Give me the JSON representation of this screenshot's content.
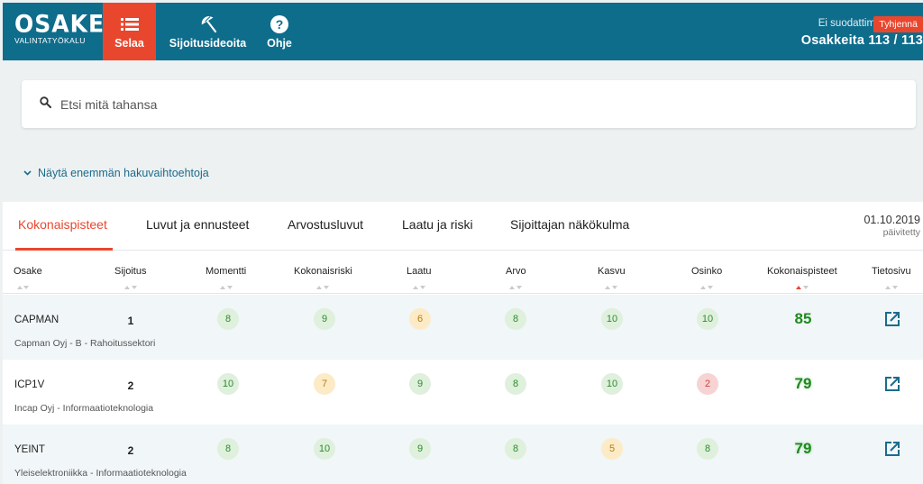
{
  "header": {
    "logo_title": "OSAKE",
    "logo_subtitle": "VALINTATYÖKALU",
    "nav": [
      {
        "label": "Selaa",
        "icon": "list-icon"
      },
      {
        "label": "Sijoitusideoita",
        "icon": "umbrella-icon"
      },
      {
        "label": "Ohje",
        "icon": "help-icon"
      }
    ],
    "filter_status": "Ei suodattimia",
    "clear_label": "Tyhjennä",
    "count_label": "Osakkeita 113 / 113"
  },
  "search": {
    "placeholder": "Etsi mitä tahansa",
    "more_options": "Näytä enemmän hakuvaihtoehtoja"
  },
  "tabs": [
    {
      "label": "Kokonaispisteet",
      "active": true
    },
    {
      "label": "Luvut ja ennusteet"
    },
    {
      "label": "Arvostusluvut"
    },
    {
      "label": "Laatu ja riski"
    },
    {
      "label": "Sijoittajan näkökulma"
    }
  ],
  "updated": {
    "date": "01.10.2019",
    "label": "päivitetty"
  },
  "columns": [
    "Osake",
    "Sijoitus",
    "Momentti",
    "Kokonaisriski",
    "Laatu",
    "Arvo",
    "Kasvu",
    "Osinko",
    "Kokonaispisteet",
    "Tietosivu"
  ],
  "sorted_column": "Kokonaispisteet",
  "colors": {
    "accent": "#e8472e",
    "header": "#0f6d8c",
    "good": "#2e8b2e",
    "medium": "#b57d0e",
    "bad": "#cc4444"
  },
  "rows": [
    {
      "ticker": "CAPMAN",
      "company": "Capman Oyj - B - Rahoitussektori",
      "rank": "1",
      "momentti": "8",
      "kokonaisriski": "9",
      "laatu": "6",
      "arvo": "8",
      "kasvu": "10",
      "osinko": "10",
      "total": "85"
    },
    {
      "ticker": "ICP1V",
      "company": "Incap Oyj - Informaatioteknologia",
      "rank": "2",
      "momentti": "10",
      "kokonaisriski": "7",
      "laatu": "9",
      "arvo": "8",
      "kasvu": "10",
      "osinko": "2",
      "total": "79"
    },
    {
      "ticker": "YEINT",
      "company": "Yleiselektroniikka - Informaatioteknologia",
      "rank": "2",
      "momentti": "8",
      "kokonaisriski": "10",
      "laatu": "9",
      "arvo": "8",
      "kasvu": "5",
      "osinko": "8",
      "total": "79"
    }
  ]
}
